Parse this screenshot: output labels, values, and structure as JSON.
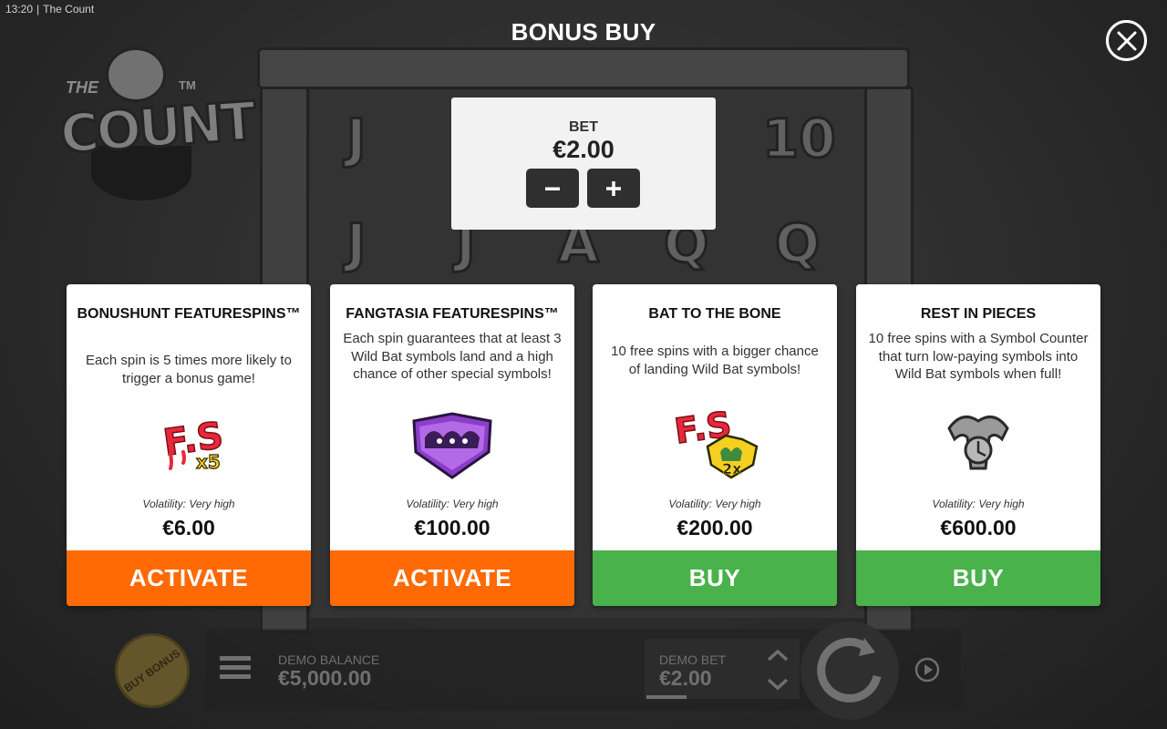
{
  "status": {
    "time": "13:20",
    "app_name": "The Count"
  },
  "logo": {
    "the": "THE",
    "count": "COUNT",
    "tm": "TM"
  },
  "reel_symbols": [
    "J",
    "10",
    "J",
    "J",
    "A",
    "Q",
    "Q"
  ],
  "dialog": {
    "title": "BONUS BUY",
    "bet": {
      "label": "BET",
      "value": "€2.00",
      "decrease_glyph": "–",
      "increase_glyph": "+"
    }
  },
  "cards": [
    {
      "title": "BONUSHUNT FEATURESPINS™",
      "description": "Each spin is 5 times more likely to trigger a bonus game!",
      "icon": "fs-x5-icon",
      "icon_text": "x5",
      "volatility": "Volatility: Very high",
      "price": "€6.00",
      "button": "ACTIVATE",
      "button_color": "#ff6a05"
    },
    {
      "title": "FANGTASIA FEATURESPINS™",
      "description": "Each spin guarantees that at least 3 Wild Bat symbols land and a high chance of other special symbols!",
      "icon": "wild-bats-icon",
      "volatility": "Volatility: Very high",
      "price": "€100.00",
      "button": "ACTIVATE",
      "button_color": "#ff6a05"
    },
    {
      "title": "BAT TO THE BONE",
      "description": "10 free spins with a bigger chance of landing Wild Bat symbols!",
      "icon": "fs-wild-bat-2x-icon",
      "icon_text": "2x",
      "volatility": "Volatility: Very high",
      "price": "€200.00",
      "button": "BUY",
      "button_color": "#49b24b"
    },
    {
      "title": "REST IN PIECES",
      "description": "10 free spins with a Symbol Counter that turn low-paying symbols into Wild Bat symbols when full!",
      "icon": "grey-bat-icon",
      "volatility": "Volatility: Very high",
      "price": "€600.00",
      "button": "BUY",
      "button_color": "#49b24b"
    }
  ],
  "bottom_bar": {
    "buy_bonus": "BUY BONUS",
    "demo_balance_label": "DEMO BALANCE",
    "demo_balance_value": "€5,000.00",
    "demo_bet_label": "DEMO BET",
    "demo_bet_value": "€2.00"
  },
  "colors": {
    "accent_orange": "#ff6a05",
    "accent_green": "#49b24b"
  }
}
